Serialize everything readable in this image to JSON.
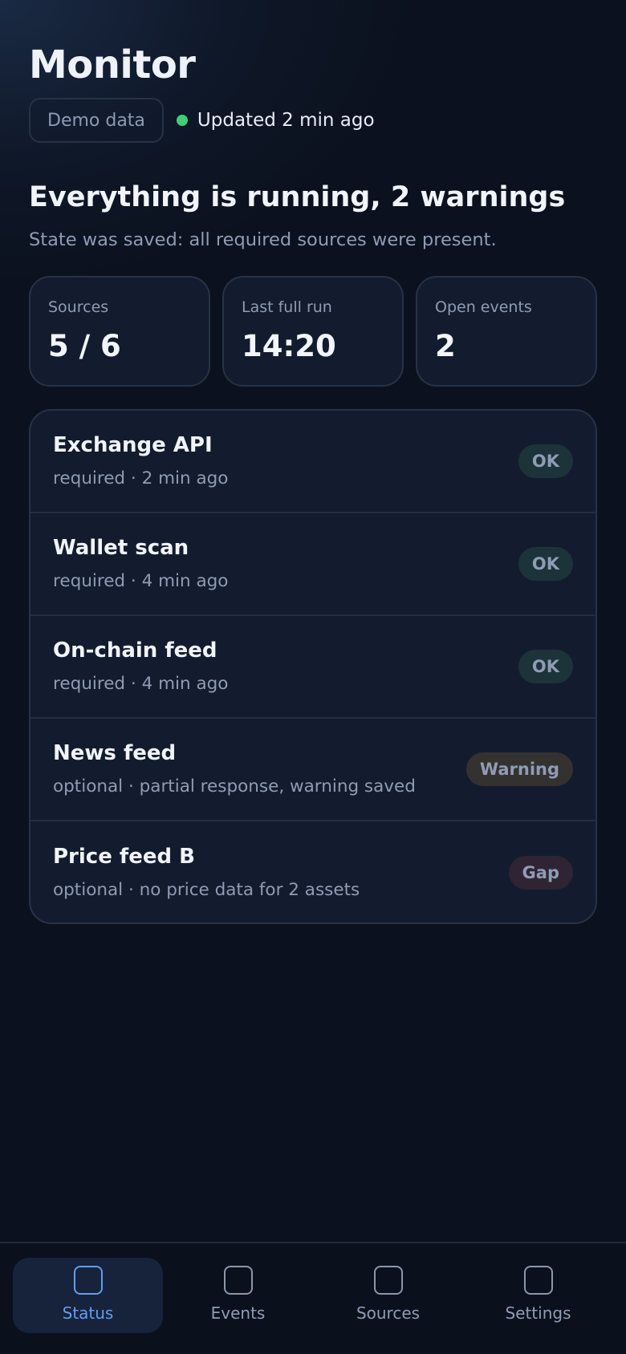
{
  "app": {
    "title": "Monitor",
    "demo_label": "Demo data",
    "updated_text": "Updated 2 min ago"
  },
  "summary": {
    "headline": "Everything is running, 2 warnings",
    "subline": "State was saved: all required sources were present."
  },
  "stats": [
    {
      "label": "Sources",
      "value": "5 / 6"
    },
    {
      "label": "Last full run",
      "value": "14:20"
    },
    {
      "label": "Open events",
      "value": "2"
    }
  ],
  "sources": [
    {
      "name": "Exchange API",
      "detail": "required · 2 min ago",
      "status": "OK",
      "kind": "ok"
    },
    {
      "name": "Wallet scan",
      "detail": "required · 4 min ago",
      "status": "OK",
      "kind": "ok"
    },
    {
      "name": "On-chain feed",
      "detail": "required · 4 min ago",
      "status": "OK",
      "kind": "ok"
    },
    {
      "name": "News feed",
      "detail": "optional · partial response, warning saved",
      "status": "Warning",
      "kind": "warn"
    },
    {
      "name": "Price feed B",
      "detail": "optional · no price data for 2 assets",
      "status": "Gap",
      "kind": "gap"
    }
  ],
  "tabs": [
    {
      "label": "Status",
      "icon": "status-icon",
      "active": true
    },
    {
      "label": "Events",
      "icon": "events-icon",
      "active": false
    },
    {
      "label": "Sources",
      "icon": "sources-icon",
      "active": false
    },
    {
      "label": "Settings",
      "icon": "settings-icon",
      "active": false
    }
  ],
  "colors": {
    "background": "#0b111e",
    "accent": "#5d9ef6",
    "status_dot": "#3fcf72"
  }
}
